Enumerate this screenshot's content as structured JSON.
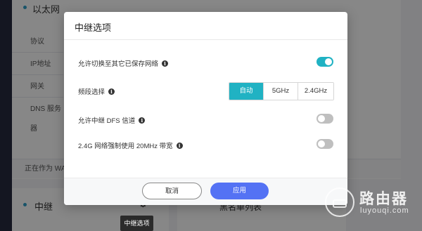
{
  "background": {
    "section_title": "以太网",
    "fields": [
      "协议",
      "IP地址",
      "网关",
      "DNS 服务器"
    ],
    "status_text": "正在作为 WA",
    "card2_title": "中继",
    "card3_title": "黑名单列表"
  },
  "tooltip": "中继选项",
  "modal": {
    "title": "中继选项",
    "rows": [
      {
        "label": "允许切换至其它已保存网络",
        "type": "toggle",
        "on": true
      },
      {
        "label": "频段选择",
        "type": "segmented",
        "options": [
          "自动",
          "5GHz",
          "2.4GHz"
        ],
        "selected": "自动"
      },
      {
        "label": "允许中继 DFS 信道",
        "type": "toggle",
        "on": false
      },
      {
        "label": "2.4G 网络强制使用 20MHz 带宽",
        "type": "toggle",
        "on": false
      }
    ],
    "cancel_label": "取消",
    "apply_label": "应用"
  },
  "watermark": {
    "title": "路由器",
    "subtitle": "luyouqi.com"
  },
  "colors": {
    "accent": "#20b2c3",
    "primary_button": "#5472f4",
    "toggle_off": "#bfbfbf"
  },
  "icons": {
    "info": "info-circle-icon",
    "gear": "gear-icon"
  }
}
